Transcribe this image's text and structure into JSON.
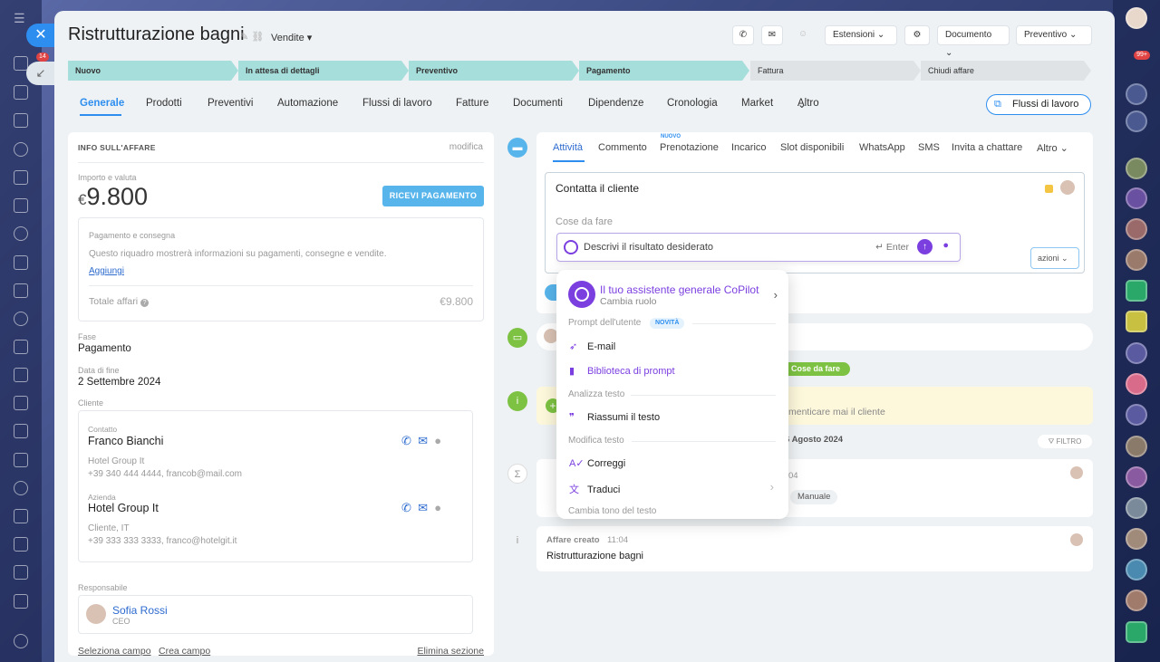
{
  "deal": {
    "title": "Ristrutturazione bagni",
    "pipeline": "Vendite"
  },
  "toolbar": {
    "extensions": "Estensioni",
    "document": "Documento",
    "quote": "Preventivo"
  },
  "stages": [
    "Nuovo",
    "In attesa di dettagli",
    "Preventivo",
    "Pagamento",
    "Fattura",
    "Chiudi affare"
  ],
  "tabs": [
    "Generale",
    "Prodotti",
    "Preventivi",
    "Automazione",
    "Flussi di lavoro",
    "Fatture",
    "Documenti",
    "Dipendenze",
    "Cronologia",
    "Market",
    "Altro"
  ],
  "workflows_button": "Flussi di lavoro",
  "info": {
    "header": "INFO SULL'AFFARE",
    "edit": "modifica",
    "amount_label": "Importo e valuta",
    "currency": "€",
    "amount": "9.800",
    "pay_button": "RICEVI PAGAMENTO",
    "payment_title": "Pagamento e consegna",
    "payment_desc": "Questo riquadro mostrerà informazioni su pagamenti, consegne e vendite.",
    "add": "Aggiungi",
    "total_label": "Totale affari",
    "total": "€9.800",
    "stage_label": "Fase",
    "stage": "Pagamento",
    "end_label": "Data di fine",
    "end": "2 Settembre 2024",
    "client_label": "Cliente",
    "contact_label": "Contatto",
    "contact": "Franco Bianchi",
    "contact_info": "Hotel Group It",
    "contact_details": "+39 340 444 4444, francob@mail.com",
    "company_label": "Azienda",
    "company": "Hotel Group It",
    "company_info": "Cliente, IT",
    "company_details": "+39 333 333 3333, franco@hotelgit.it",
    "resp_label": "Responsabile",
    "resp_name": "Sofia Rossi",
    "resp_role": "CEO",
    "select_field": "Seleziona campo",
    "create_field": "Crea campo",
    "delete_section": "Elimina sezione"
  },
  "activity": {
    "tabs": [
      "Attività",
      "Commento",
      "Prenotazione",
      "Incarico",
      "Slot disponibili",
      "WhatsApp",
      "SMS",
      "Invita a chattare",
      "Altro"
    ],
    "new_badge": "NUOVO",
    "task_title": "Contatta il cliente",
    "todo": "Cose da fare",
    "ai_placeholder": "Descrivi il risultato desiderato",
    "enter": "Enter",
    "actions": "azioni"
  },
  "menu": {
    "title": "Il tuo assistente generale CoPilot",
    "subtitle": "Cambia ruolo",
    "sec1": "Prompt dell'utente",
    "new": "NOVITÀ",
    "email": "E-mail",
    "library": "Biblioteca di prompt",
    "sec2": "Analizza testo",
    "summarize": "Riassumi il testo",
    "sec3": "Modifica testo",
    "correct": "Correggi",
    "translate": "Traduci",
    "sec4": "Cambia tono del testo"
  },
  "timeline": {
    "todo_pill": "Cose da fare",
    "reminder": "menticare mai il cliente",
    "date": "6 Agosto 2024",
    "filter": "FILTRO",
    "time1": "04",
    "manual": "Manuale",
    "created": "Affare creato",
    "time2": "11:04",
    "created_name": "Ristrutturazione bagni"
  },
  "badges": {
    "left_top": "14",
    "right_top": "99+"
  }
}
